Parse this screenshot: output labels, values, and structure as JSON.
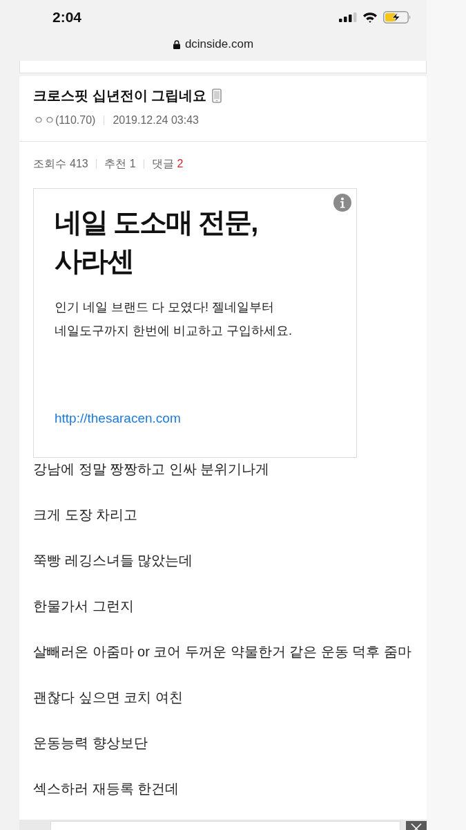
{
  "status_bar": {
    "time": "2:04"
  },
  "address_bar": {
    "url": "dcinside.com"
  },
  "post": {
    "title": "크로스핏 십년전이 그립네요",
    "author": "ㅇㅇ(110.70)",
    "date": "2019.12.24 03:43",
    "stats": [
      {
        "label": "조회수",
        "value": "413",
        "highlight": false
      },
      {
        "label": "추천",
        "value": "1",
        "highlight": false
      },
      {
        "label": "댓글",
        "value": "2",
        "highlight": true
      }
    ]
  },
  "ad": {
    "headline": "네일 도소매 전문,\n사라센",
    "description": "인기 네일 브랜드 다 모였다! 젤네일부터\n네일도구까지 한번에 비교하고 구입하세요.",
    "link": "http://thesaracen.com"
  },
  "body": [
    "강남에 정말 짱짱하고 인싸 분위기나게",
    "크게 도장 차리고",
    "쭉빵 레깅스녀들 많았는데",
    "한물가서 그런지",
    "살빼러온 아줌마 or 코어 두꺼운 약물한거 같은 운동 덕후 줌마",
    "괜찮다 싶으면 코치 여친",
    "운동능력 향상보단",
    "섹스하러 재등록 한건데"
  ]
}
